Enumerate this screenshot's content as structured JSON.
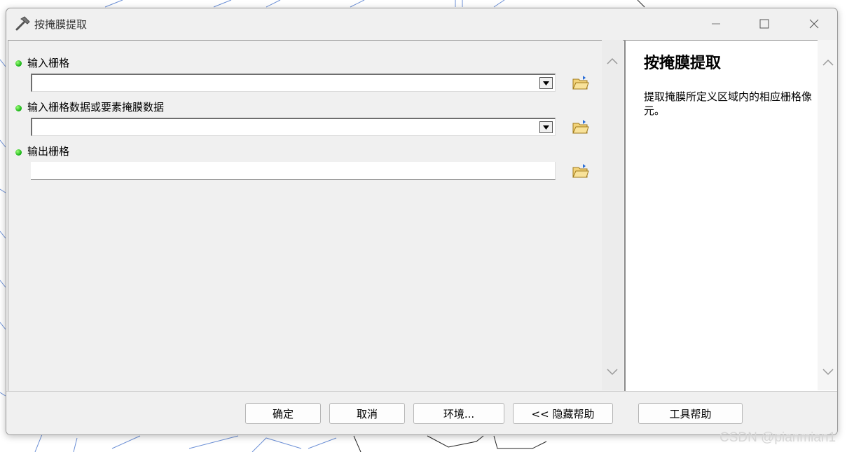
{
  "window": {
    "title": "按掩膜提取"
  },
  "params": [
    {
      "label": "输入栅格",
      "type": "combo",
      "value": ""
    },
    {
      "label": "输入栅格数据或要素掩膜数据",
      "type": "combo",
      "value": ""
    },
    {
      "label": "输出栅格",
      "type": "text",
      "value": ""
    }
  ],
  "help": {
    "title": "按掩膜提取",
    "text": "提取掩膜所定义区域内的相应栅格像元。"
  },
  "footer": {
    "ok": "确定",
    "cancel": "取消",
    "env": "环境...",
    "hide_help": "<< 隐藏帮助",
    "tool_help": "工具帮助"
  },
  "watermark": "CSDN @pianmian1",
  "icons": {
    "title": "hammer-icon",
    "browse": "folder-open-icon",
    "dropdown": "dropdown-arrow-icon"
  },
  "colors": {
    "required_dot": "#10b010",
    "window_bg": "#f0f0f0"
  }
}
